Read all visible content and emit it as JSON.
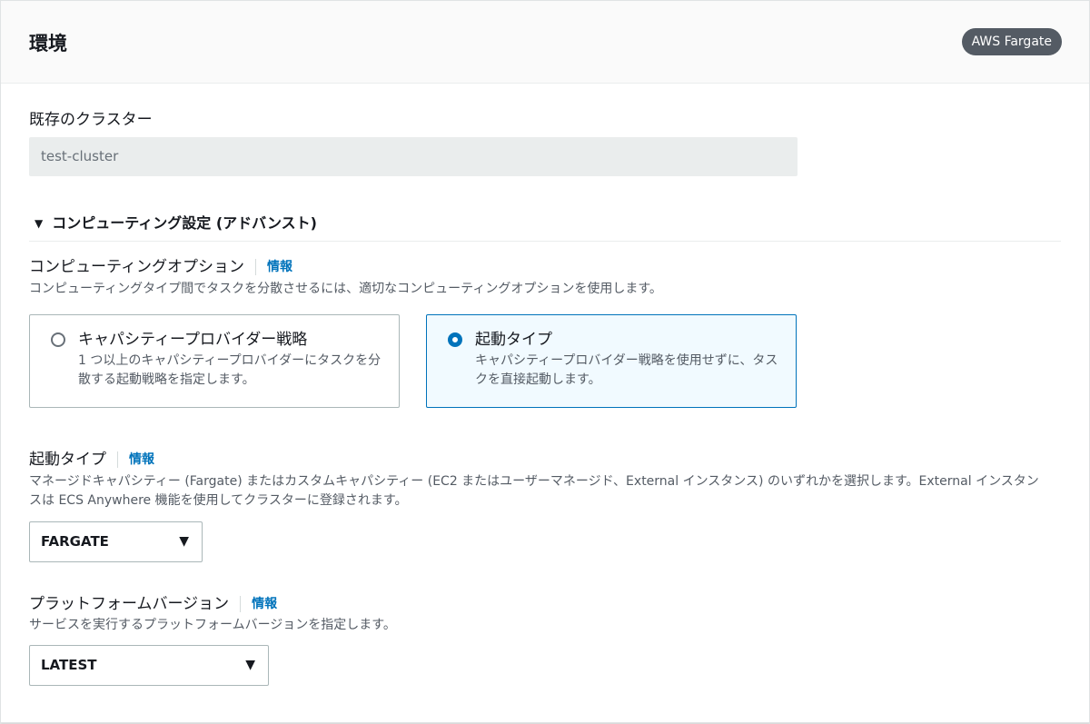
{
  "header": {
    "title": "環境",
    "badge": "AWS Fargate"
  },
  "existing_cluster": {
    "label": "既存のクラスター",
    "value": "test-cluster"
  },
  "advanced_section": {
    "caret": "▼",
    "title": "コンピューティング設定 (アドバンスト)"
  },
  "compute_options": {
    "label": "コンピューティングオプション",
    "info": "情報",
    "description": "コンピューティングタイプ間でタスクを分散させるには、適切なコンピューティングオプションを使用します。",
    "tiles": [
      {
        "title": "キャパシティープロバイダー戦略",
        "description": "1 つ以上のキャパシティープロバイダーにタスクを分散する起動戦略を指定します。",
        "selected": false
      },
      {
        "title": "起動タイプ",
        "description": "キャパシティープロバイダー戦略を使用せずに、タスクを直接起動します。",
        "selected": true
      }
    ]
  },
  "launch_type": {
    "label": "起動タイプ",
    "info": "情報",
    "description": "マネージドキャパシティー (Fargate) またはカスタムキャパシティー (EC2 またはユーザーマネージド、External インスタンス) のいずれかを選択します。External インスタンスは ECS Anywhere 機能を使用してクラスターに登録されます。",
    "selected": "FARGATE",
    "caret": "▼"
  },
  "platform_version": {
    "label": "プラットフォームバージョン",
    "info": "情報",
    "description": "サービスを実行するプラットフォームバージョンを指定します。",
    "selected": "LATEST",
    "caret": "▼"
  },
  "colors": {
    "accent": "#0073bb",
    "badge_bg": "#545b64",
    "selected_tile_bg": "#f1faff"
  }
}
